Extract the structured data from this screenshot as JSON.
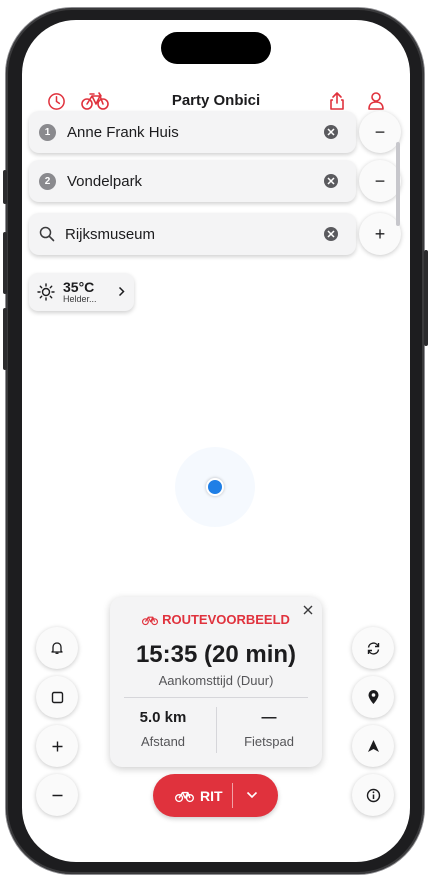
{
  "header": {
    "title": "Party Onbici",
    "left_icons": [
      "history-icon",
      "bicycle-icon"
    ],
    "right_icons": [
      "share-icon",
      "profile-icon"
    ]
  },
  "route_inputs": [
    {
      "badge": "1",
      "label": "Anne Frank Huis",
      "action": "−"
    },
    {
      "badge": "2",
      "label": "Vondelpark",
      "action": "−"
    },
    {
      "badge": "",
      "label": "Rijksmuseum",
      "action": "+"
    }
  ],
  "weather": {
    "temperature": "35°C",
    "description": "Helder..."
  },
  "route_card": {
    "heading": "ROUTEVOORBEELD",
    "time": "15:35 (20 min)",
    "subtitle": "Aankomsttijd (Duur)",
    "distance_value": "5.0 km",
    "distance_label": "Afstand",
    "path_value": "—",
    "path_label": "Fietspad"
  },
  "map_controls_left": [
    "bell-icon",
    "stop-icon",
    "zoom-in-icon",
    "zoom-out-icon"
  ],
  "map_controls_right": [
    "refresh-icon",
    "location-pin-icon",
    "navigate-arrow-icon",
    "info-icon"
  ],
  "ride_button": {
    "label": "RIT"
  },
  "colors": {
    "accent": "#e0323d",
    "location": "#1f7fe6"
  }
}
